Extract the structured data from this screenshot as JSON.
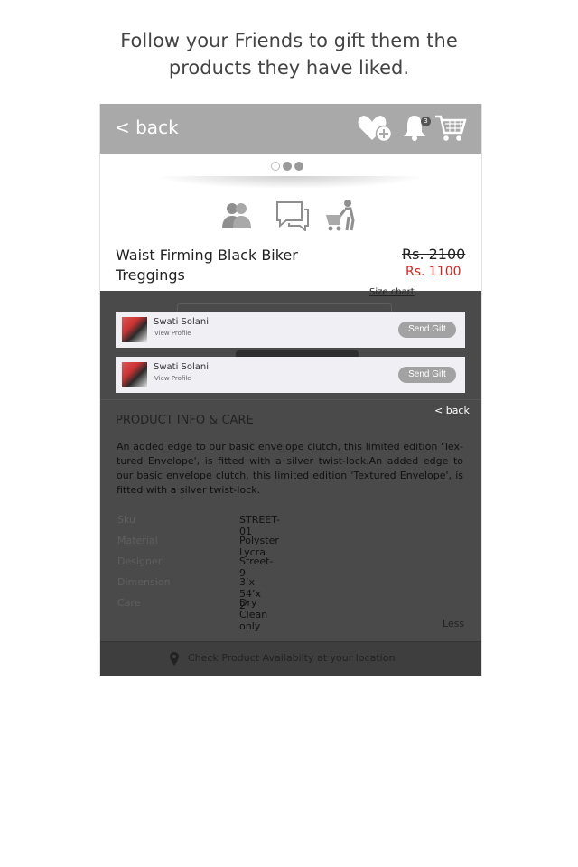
{
  "caption": {
    "line1": "Follow your Friends to gift them the",
    "line2": "products they have liked."
  },
  "header": {
    "back_label": "< back",
    "notification_count": "3",
    "icons": [
      "heart-plus-icon",
      "bell-icon",
      "cart-icon"
    ]
  },
  "carousel": {
    "total": 3,
    "active": 1
  },
  "actions": {
    "icons": [
      "friends-icon",
      "chat-icon",
      "shopping-trolley-icon"
    ]
  },
  "product": {
    "title": "Waist Firming Black Biker Treggings",
    "old_price": "Rs. 2100",
    "new_price": "Rs. 1100",
    "size_chart_label": "Size chart"
  },
  "friends": [
    {
      "name": "Swati Solani",
      "profile_label": "View Profile",
      "button_label": "Send Gift"
    },
    {
      "name": "Swati Solani",
      "profile_label": "View Profile",
      "button_label": "Send Gift"
    }
  ],
  "info": {
    "back_label": "< back",
    "section_title": "PRODUCT INFO & CARE",
    "description": "An added edge to our basic envelope clutch, this limited edition 'Tex-tured Envelope', is fitted with a silver twist-lock.An added edge to our basic envelope clutch, this limited edition 'Textured Envelope', is fitted with a silver twist-lock.",
    "specs": [
      {
        "label": "Sku",
        "value": "STREET-01"
      },
      {
        "label": "Material",
        "value": "Polyster Lycra"
      },
      {
        "label": "Designer",
        "value": "Street-9"
      },
      {
        "label": "Dimension",
        "value": "3’x 54’x 2’"
      },
      {
        "label": "Care",
        "value": "Dry Clean only"
      }
    ],
    "less_label": "Less"
  },
  "availability": {
    "label": "Check Product Availabilty at your location"
  },
  "colors": {
    "top_bar": "#a9a9a9",
    "overlay": "#4a4a4a",
    "sale_price": "#e0201b",
    "button": "#a2a2a2"
  }
}
